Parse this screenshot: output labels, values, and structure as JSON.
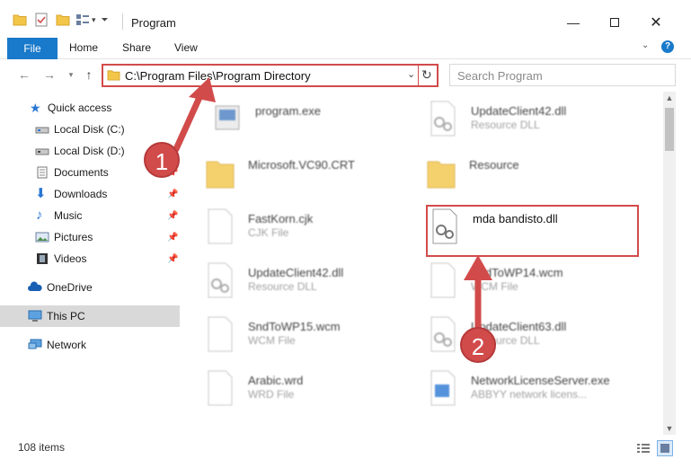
{
  "window": {
    "title": "Program"
  },
  "ribbon": {
    "tabs": [
      "File",
      "Home",
      "Share",
      "View"
    ]
  },
  "address": {
    "path": "C:\\Program Files\\Program Directory"
  },
  "search": {
    "placeholder": "Search Program"
  },
  "nav_pane": {
    "items": [
      {
        "label": "Quick access",
        "icon": "star-icon"
      },
      {
        "label": "Local Disk (C:)",
        "icon": "drive-icon"
      },
      {
        "label": "Local Disk (D:)",
        "icon": "drive-icon"
      },
      {
        "label": "Documents",
        "icon": "documents-icon",
        "pinned": true
      },
      {
        "label": "Downloads",
        "icon": "download-icon",
        "pinned": true
      },
      {
        "label": "Music",
        "icon": "music-icon",
        "pinned": true
      },
      {
        "label": "Pictures",
        "icon": "pictures-icon",
        "pinned": true
      },
      {
        "label": "Videos",
        "icon": "videos-icon",
        "pinned": true
      },
      {
        "label": "OneDrive",
        "icon": "cloud-icon"
      },
      {
        "label": "This PC",
        "icon": "computer-icon",
        "selected": true
      },
      {
        "label": "Network",
        "icon": "network-icon"
      }
    ]
  },
  "files": [
    {
      "name": "program.exe",
      "type": "",
      "icon": "exe-icon"
    },
    {
      "name": "UpdateClient42.dll",
      "type": "Resource DLL",
      "icon": "dll-icon"
    },
    {
      "name": "Microsoft.VC90.CRT",
      "type": "",
      "icon": "folder-icon"
    },
    {
      "name": "Resource",
      "type": "",
      "icon": "folder-icon"
    },
    {
      "name": "FastKorn.cjk",
      "type": "CJK File",
      "icon": "file-icon"
    },
    {
      "name": "mda bandisto.dll",
      "type": "",
      "icon": "dll-icon",
      "highlighted": true
    },
    {
      "name": "UpdateClient42.dll",
      "type": "Resource DLL",
      "icon": "dll-icon"
    },
    {
      "name": "SndToWP14.wcm",
      "type": "WCM File",
      "icon": "file-icon"
    },
    {
      "name": "SndToWP15.wcm",
      "type": "WCM File",
      "icon": "file-icon"
    },
    {
      "name": "UpdateClient63.dll",
      "type": "Resource DLL",
      "icon": "dll-icon"
    },
    {
      "name": "Arabic.wrd",
      "type": "WRD File",
      "icon": "file-icon"
    },
    {
      "name": "NetworkLicenseServer.exe",
      "type": "ABBYY network licens...",
      "icon": "exe-icon"
    }
  ],
  "status": {
    "item_count": "108 items"
  },
  "annotations": {
    "step1": "1",
    "step2": "2",
    "color": "#d24b4b"
  }
}
